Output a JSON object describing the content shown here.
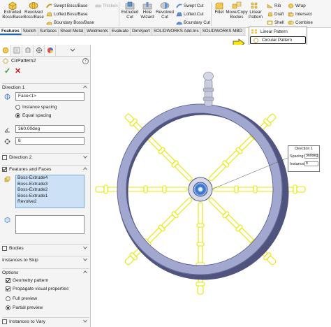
{
  "ribbon": {
    "extruded_boss": "Extruded Boss/Base",
    "revolved_boss": "Revolved Boss/Base",
    "swept_boss": "Swept Boss/Base",
    "lofted_boss": "Lofted Boss/Base",
    "boundary_boss": "Boundary Boss/Base",
    "thicken": "Thicken",
    "extruded_cut": "Extruded Cut",
    "hole_wizard": "Hole Wizard",
    "revolved_cut": "Revolved Cut",
    "swept_cut": "Swept Cut",
    "lofted_cut": "Lofted Cut",
    "boundary_cut": "Boundary Cut",
    "fillet": "Fillet",
    "move_copy": "Move/Copy Bodies",
    "linear_pattern": "Linear Pattern",
    "rib": "Rib",
    "draft": "Draft",
    "shell": "Shell",
    "wrap": "Wrap",
    "intersect": "Intersect",
    "combine": "Combine"
  },
  "tabs": [
    "Features",
    "Sketch",
    "Surfaces",
    "Sheet Metal",
    "Weldments",
    "Evaluate",
    "DimXpert",
    "SOLIDWORKS Add-Ins",
    "SOLIDWORKS MBD"
  ],
  "dropdown": {
    "linear_pattern": "Linear Pattern",
    "circular_pattern": "Circular Pattern"
  },
  "property_manager": {
    "title": "CirPattern2",
    "help": "?",
    "ok": "✓",
    "cancel": "✕",
    "direction1": {
      "label": "Direction 1",
      "face": "Face<1>",
      "instance_spacing": "Instance spacing",
      "equal_spacing": "Equal spacing",
      "angle": "360.00deg",
      "instances": "8"
    },
    "direction2": {
      "label": "Direction 2",
      "checked": false
    },
    "features_and_faces": {
      "label": "Features and Faces",
      "checked": true,
      "items": [
        "Boss-Extrude4",
        "Boss-Extrude3",
        "Boss-Extrude2",
        "Boss-Extrude1",
        "Revolve2"
      ]
    },
    "bodies": {
      "label": "Bodies",
      "checked": false
    },
    "instances_to_skip": "Instances to Skip",
    "options": {
      "label": "Options",
      "geometry_pattern": "Geometry pattern",
      "propagate_visual": "Propagate visual properties",
      "full_preview": "Full preview",
      "partial_preview": "Partial preview"
    },
    "instances_to_vary": {
      "label": "Instances to Vary",
      "checked": false
    }
  },
  "callout": {
    "title": "Direction 1",
    "spacing_label": "Spacing:",
    "spacing_value": "360deg",
    "instances_label": "Instances:",
    "instances_value": "8"
  },
  "colors": {
    "wheel": "#9aa0c8",
    "wheel_dark": "#3c4070",
    "spoke_yellow": "#e8e800",
    "hub": "#2a6ec8",
    "accent": "#1d66b3",
    "ok": "#2d9b2d",
    "cancel": "#c81e1e"
  }
}
